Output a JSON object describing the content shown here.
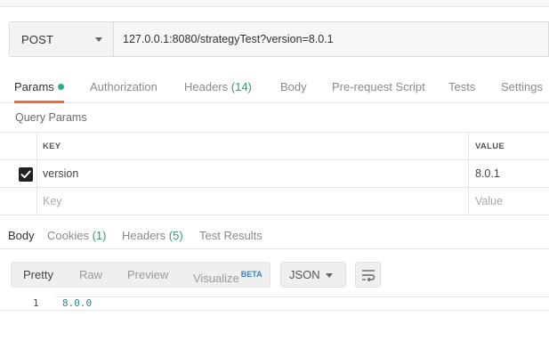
{
  "request": {
    "method": "POST",
    "url": "127.0.0.1:8080/strategyTest?version=8.0.1"
  },
  "request_tabs": {
    "params": "Params",
    "authorization": "Authorization",
    "headers": "Headers",
    "headers_count": "(14)",
    "body": "Body",
    "pre_request_script": "Pre-request Script",
    "tests": "Tests",
    "settings": "Settings"
  },
  "query_params": {
    "title": "Query Params",
    "key_header": "KEY",
    "value_header": "VALUE",
    "rows": [
      {
        "key": "version",
        "value": "8.0.1",
        "checked": true
      }
    ],
    "key_placeholder": "Key",
    "value_placeholder": "Value"
  },
  "response_tabs": {
    "body": "Body",
    "cookies": "Cookies",
    "cookies_count": "(1)",
    "headers": "Headers",
    "headers_count": "(5)",
    "test_results": "Test Results"
  },
  "view_modes": {
    "pretty": "Pretty",
    "raw": "Raw",
    "preview": "Preview",
    "visualize": "Visualize",
    "beta": "BETA",
    "format": "JSON"
  },
  "response_body": {
    "line_number": "1",
    "content": "8.0.0"
  },
  "colors": {
    "active_tab_underline": "#f26b3a",
    "count_green": "#2e9e6b",
    "dot_green": "#26b47f",
    "beta_blue": "#3c7fc7"
  }
}
